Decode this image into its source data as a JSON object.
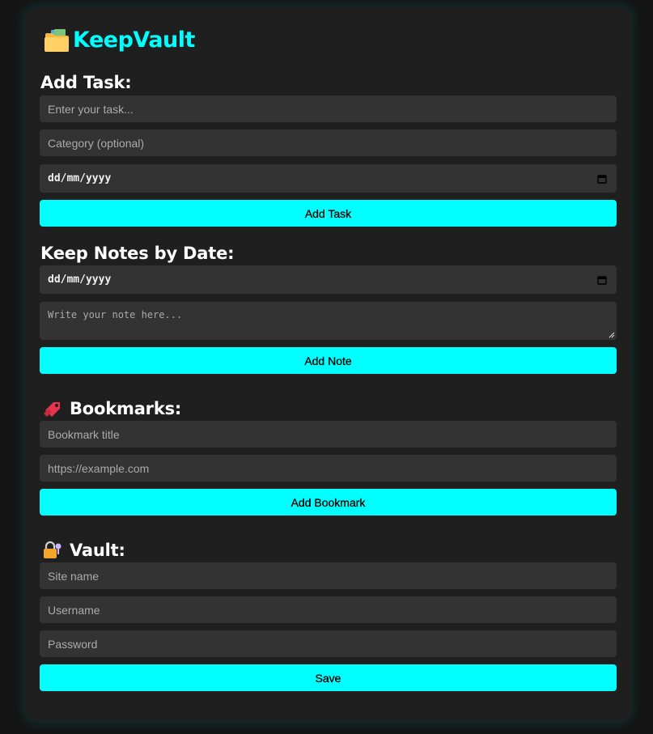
{
  "app": {
    "title": "KeepVault",
    "icon": "folder-icon"
  },
  "tasks": {
    "heading": "Add Task:",
    "task_placeholder": "Enter your task...",
    "category_placeholder": "Category (optional)",
    "date_placeholder": "dd/mm/yyyy",
    "button_label": "Add Task"
  },
  "notes": {
    "heading": "Keep Notes by Date:",
    "date_placeholder": "dd/mm/yyyy",
    "note_placeholder": "Write your note here...",
    "button_label": "Add Note"
  },
  "bookmarks": {
    "heading": "Bookmarks:",
    "icon": "bookmark-icon",
    "title_placeholder": "Bookmark title",
    "url_placeholder": "https://example.com",
    "button_label": "Add Bookmark"
  },
  "vault": {
    "heading": "Vault:",
    "icon": "lock-key-icon",
    "site_placeholder": "Site name",
    "username_placeholder": "Username",
    "password_placeholder": "Password",
    "button_label": "Save"
  },
  "colors": {
    "accent": "#00ffff",
    "background": "#141414",
    "card": "#1f1f20",
    "input": "#333333"
  }
}
